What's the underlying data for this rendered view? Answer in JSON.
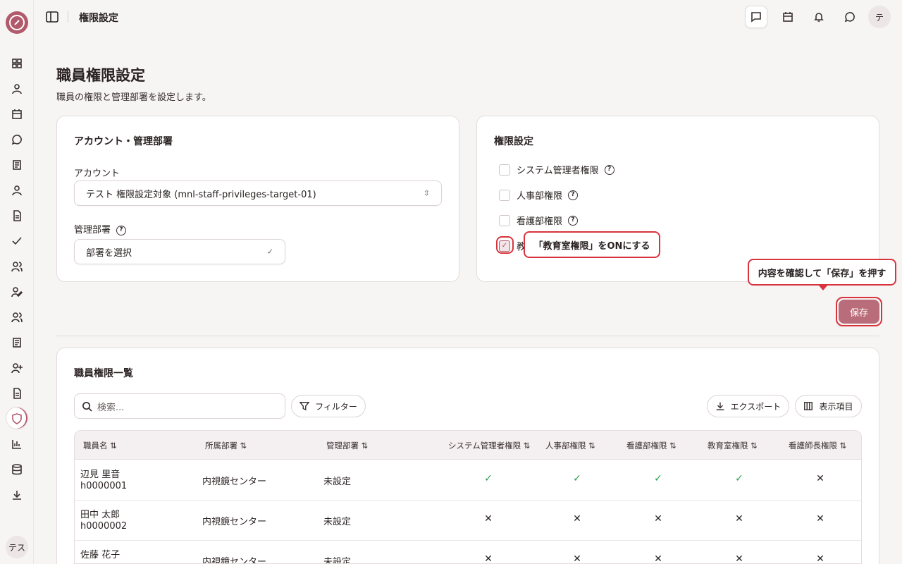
{
  "header": {
    "title": "権限設定",
    "avatar_initial": "テ"
  },
  "sidebar": {
    "user_initials": "テス"
  },
  "page": {
    "title": "職員権限設定",
    "subtitle": "職員の権限と管理部署を設定します。"
  },
  "account_card": {
    "title": "アカウント・管理部署",
    "account_label": "アカウント",
    "account_value": "テスト 権限設定対象 (mnl-staff-privileges-target-01)",
    "dept_label": "管理部署",
    "dept_placeholder": "部署を選択"
  },
  "permission_card": {
    "title": "権限設定",
    "options": [
      {
        "label": "システム管理者権限",
        "checked": false
      },
      {
        "label": "人事部権限",
        "checked": false
      },
      {
        "label": "看護部権限",
        "checked": false
      },
      {
        "label": "教育室権限",
        "checked": true
      }
    ],
    "partial_label": "教"
  },
  "callouts": {
    "checkbox_hint": "「教育室権限」をONにする",
    "save_hint": "内容を確認して「保存」を押す"
  },
  "save_label": "保存",
  "list": {
    "title": "職員権限一覧",
    "search_placeholder": "検索...",
    "filter_label": "フィルター",
    "export_label": "エクスポート",
    "columns_label": "表示項目",
    "columns": [
      "職員名 ⇅",
      "所属部署 ⇅",
      "管理部署 ⇅",
      "システム管理者権限 ⇅",
      "人事部権限 ⇅",
      "看護部権限 ⇅",
      "教育室権限 ⇅",
      "看護師長権限 ⇅"
    ],
    "rows": [
      {
        "name": "辺見 里音",
        "id": "h0000001",
        "dept": "内視鏡センター",
        "managed": "未設定",
        "flags": [
          true,
          true,
          true,
          true,
          false
        ]
      },
      {
        "name": "田中 太郎",
        "id": "h0000002",
        "dept": "内視鏡センター",
        "managed": "未設定",
        "flags": [
          false,
          false,
          false,
          false,
          false
        ]
      },
      {
        "name": "佐藤 花子",
        "id": "",
        "dept": "内視鏡センター",
        "managed": "未設定",
        "flags": [
          false,
          false,
          false,
          false,
          false
        ]
      }
    ]
  },
  "colors": {
    "accent": "#b15a6b",
    "highlight": "#d8343e",
    "check": "#2a9d4a"
  }
}
